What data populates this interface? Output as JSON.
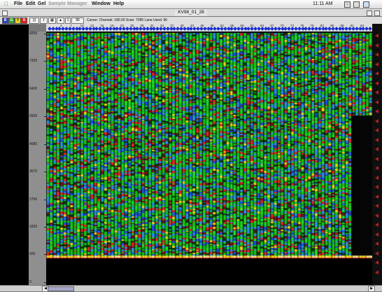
{
  "menubar": {
    "items": [
      {
        "label": "File",
        "enabled": true
      },
      {
        "label": "Edit",
        "enabled": true
      },
      {
        "label": "Gel",
        "enabled": true
      },
      {
        "label": "Sample",
        "enabled": false
      },
      {
        "label": "Manager",
        "enabled": false
      },
      {
        "label": "Window",
        "enabled": true
      },
      {
        "label": "Help",
        "enabled": true
      }
    ],
    "clock": "11:11 AM"
  },
  "window": {
    "title": "KV98_01_28"
  },
  "toolbar": {
    "color_buttons": [
      {
        "label": "B",
        "color": "#2b3fd8"
      },
      {
        "label": "G",
        "color": "#23b023"
      },
      {
        "label": "Y",
        "color": "#e8d020"
      },
      {
        "label": "R",
        "color": "#e02020"
      }
    ],
    "info_icon": "i",
    "lane_field": "1",
    "lane_count": "96",
    "status": "Cursor: Channel: 180.00 Scan: 7095   Lane Used: 96"
  },
  "lane_numbers": [
    "4",
    "7",
    "10",
    "13",
    "16",
    "19",
    "22",
    "25",
    "28",
    "31",
    "34",
    "37",
    "40",
    "43",
    "46",
    "49",
    "52",
    "55",
    "58",
    "61",
    "64",
    "67",
    "70",
    "73",
    "76",
    "79",
    "82",
    "85",
    "88",
    "91",
    "94"
  ],
  "y_axis_labels": [
    "8250",
    "7335",
    "6420",
    "5500",
    "4585",
    "3670",
    "2750",
    "1835",
    "920",
    "0"
  ],
  "y_axis": {
    "min": 0,
    "max": 8250
  },
  "colors": {
    "lane_marker": "#1a2fcf",
    "arrow": "#b02020",
    "gel_palette": [
      "#0a3a0a",
      "#16c016",
      "#1fdc2a",
      "#2a8ee0",
      "#1a4fd8",
      "#e02424",
      "#e8d21a",
      "#6a1a1a"
    ]
  }
}
